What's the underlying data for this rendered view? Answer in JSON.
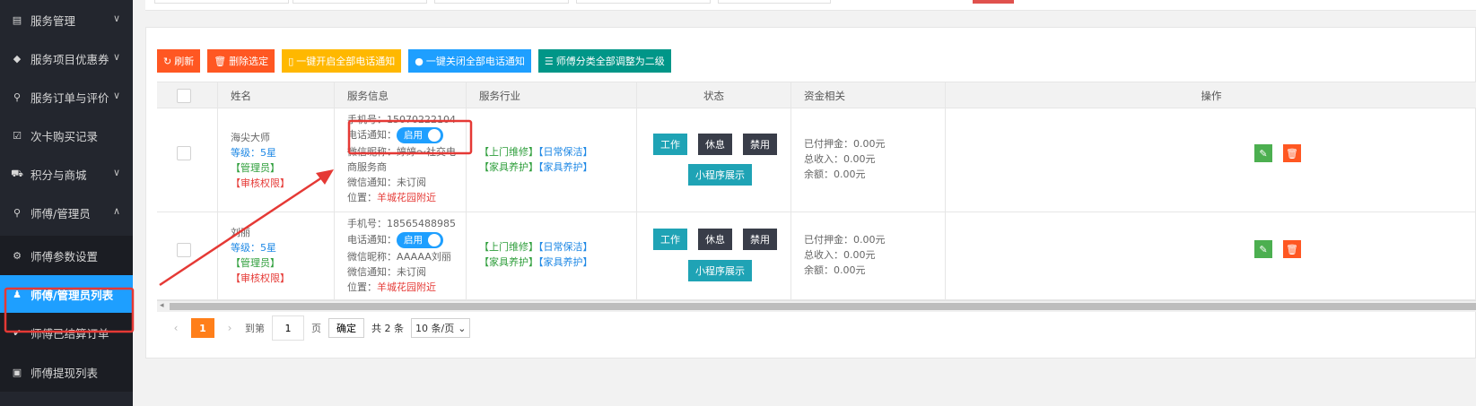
{
  "sidebar": {
    "items": [
      {
        "label": "服务管理",
        "icon": "list-icon",
        "chevron": "˅"
      },
      {
        "label": "服务项目优惠券",
        "icon": "tag-icon",
        "chevron": "˅"
      },
      {
        "label": "服务订单与评价",
        "icon": "person-icon",
        "chevron": "˅"
      },
      {
        "label": "次卡购买记录",
        "icon": "check-square-icon",
        "chevron": ""
      },
      {
        "label": "积分与商城",
        "icon": "cart-icon",
        "chevron": "˅"
      },
      {
        "label": "师傅/管理员",
        "icon": "person-icon",
        "chevron": "˄"
      }
    ],
    "subitems": [
      {
        "label": "师傅参数设置",
        "icon": "gear-icon"
      },
      {
        "label": "师傅/管理员列表",
        "icon": "users-icon"
      },
      {
        "label": "师傅已结算订单",
        "icon": "check-circle-icon"
      },
      {
        "label": "师傅提现列表",
        "icon": "money-icon"
      }
    ]
  },
  "toolbar": {
    "refresh": "刷新",
    "delete_selected": "删除选定",
    "enable_all_phone": "一键开启全部电话通知",
    "disable_all_phone": "一键关闭全部电话通知",
    "adjust_level": "师傅分类全部调整为二级"
  },
  "table": {
    "headers": {
      "name": "姓名",
      "service_info": "服务信息",
      "industry": "服务行业",
      "status": "状态",
      "funds": "资金相关",
      "actions": "操作"
    },
    "rows": [
      {
        "name": "海尖大师",
        "level": "等级：5星",
        "role": "【管理员】",
        "perm": "【审核权限】",
        "phone_label": "手机号：",
        "phone": "15070222104",
        "notify_label": "电话通知：",
        "toggle": "启用",
        "wechat": "微信昵称：婷婷～社交电商服务商",
        "sub": "微信通知：未订阅",
        "loc_label": "位置：",
        "loc": "羊城花园附近",
        "ind1": "【上门维修】",
        "ind2": "【日常保洁】",
        "ind3": "【家具养护】",
        "ind4": "【家具养护】",
        "btn_work": "工作",
        "btn_rest": "休息",
        "btn_ban": "禁用",
        "btn_mini": "小程序展示",
        "deposit": "已付押金：0.00元",
        "income": "总收入：0.00元",
        "balance": "余额：0.00元"
      },
      {
        "name": "刘丽",
        "level": "等级：5星",
        "role": "【管理员】",
        "perm": "【审核权限】",
        "phone_label": "手机号：",
        "phone": "18565488985",
        "notify_label": "电话通知：",
        "toggle": "启用",
        "wechat": "微信昵称：AAAAA刘丽",
        "sub": "微信通知：未订阅",
        "loc_label": "位置：",
        "loc": "羊城花园附近",
        "ind1": "【上门维修】",
        "ind2": "【日常保洁】",
        "ind3": "【家具养护】",
        "ind4": "【家具养护】",
        "btn_work": "工作",
        "btn_rest": "休息",
        "btn_ban": "禁用",
        "btn_mini": "小程序展示",
        "deposit": "已付押金：0.00元",
        "income": "总收入：0.00元",
        "balance": "余额：0.00元"
      }
    ]
  },
  "pager": {
    "prev": "‹",
    "current": "1",
    "next": "›",
    "goto": "到第",
    "page_value": "1",
    "page_unit": "页",
    "confirm": "确定",
    "total": "共 2 条",
    "per_page": "10 条/页"
  },
  "colors": {
    "sidebar_bg": "#23262e",
    "active": "#1e9fff",
    "annotation": "#e53935"
  }
}
